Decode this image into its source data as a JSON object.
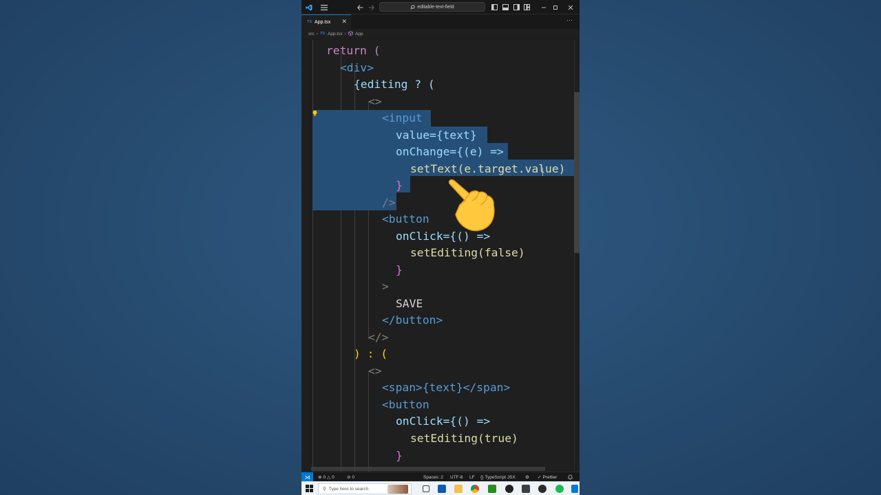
{
  "window": {
    "search_text": "editable-text-field"
  },
  "tab": {
    "badge": "TS",
    "label": "App.tsx",
    "close": "✕"
  },
  "breadcrumb": {
    "folder": "src",
    "file_badge": "TS",
    "file": "App.tsx",
    "symbol": "App"
  },
  "code_lines": [
    "return (",
    "<div>",
    "{editing ? (",
    "<>",
    "<input",
    "value={text}",
    "onChange={(e) =>",
    "setText(e.target.value)",
    "}",
    "/>",
    "<button",
    "onClick={() =>",
    "setEditing(false)",
    "}",
    ">",
    "SAVE",
    "</button>",
    "</>",
    ") : (",
    "<>",
    "<span>{text}</span>",
    "<button",
    "onClick={() =>",
    "setEditing(true)",
    "}"
  ],
  "status": {
    "errors": "0",
    "warnings": "0",
    "ports": "0",
    "spaces": "Spaces: 2",
    "encoding": "UTF-8",
    "eol": "LF",
    "language": "TypeScript JSX",
    "prettier": "Prettier"
  },
  "taskbar": {
    "search_placeholder": "Type here to search"
  },
  "colors": {
    "editor_bg": "#1f1f1f",
    "selection": "#264f78",
    "accent": "#0078d4",
    "keyword": "#c586c0",
    "tag": "#569cd6",
    "attribute": "#9cdcfe",
    "function": "#dcdcaa",
    "bracket1": "#ffd700",
    "bracket2": "#da70d6",
    "bracket3": "#179fff"
  },
  "icons": [
    "vscode-logo-icon",
    "menu-icon",
    "back-arrow-icon",
    "forward-arrow-icon",
    "search-icon",
    "layout-icon",
    "close-icon",
    "more-icon",
    "lightbulb-icon",
    "pointing-hand-icon",
    "remote-icon",
    "error-icon",
    "warning-icon",
    "bell-icon",
    "windows-start-icon"
  ]
}
